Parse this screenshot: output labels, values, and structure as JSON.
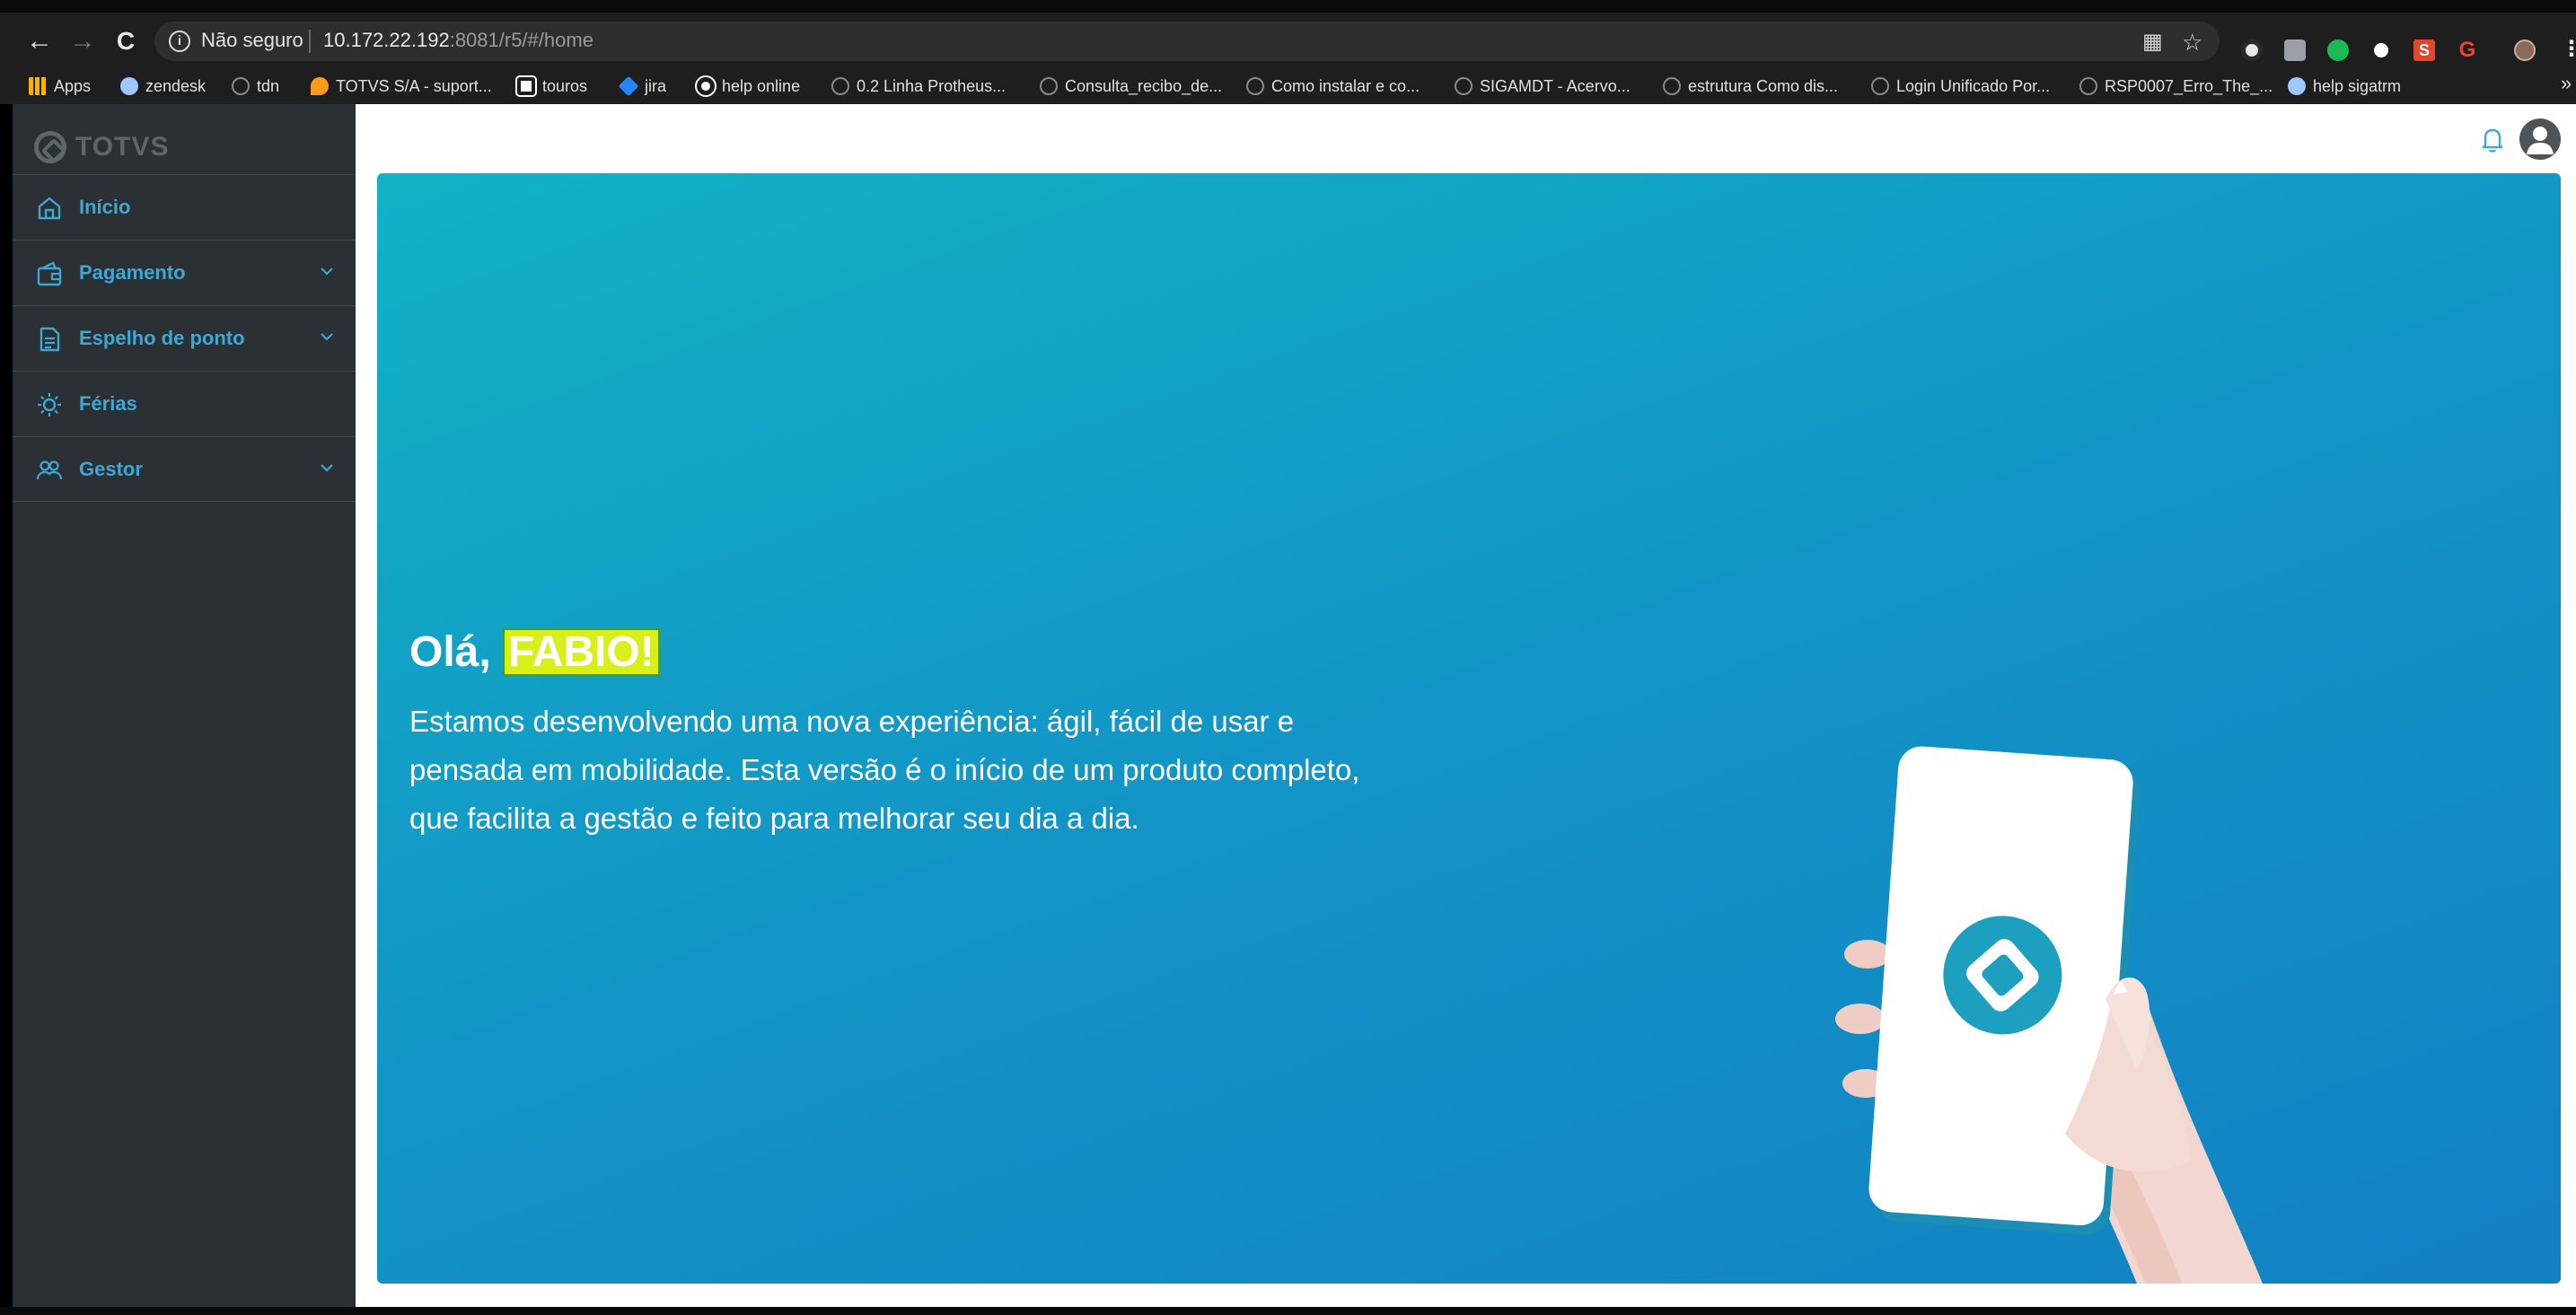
{
  "browser": {
    "security_label": "Não seguro",
    "url_host": "10.172.22.192",
    "url_rest": ":8081/r5/#/home"
  },
  "bookmarks": [
    {
      "label": "Apps",
      "icon": "apps-grid-icon",
      "color": "#f4b400"
    },
    {
      "label": "zendesk",
      "icon": "zendesk-icon",
      "color": "#9ec8ff"
    },
    {
      "label": "tdn",
      "icon": "totvs-icon",
      "color": "#8a8a8a"
    },
    {
      "label": "TOTVS S/A - suport...",
      "icon": "flame-icon",
      "color": "#ff9a1a"
    },
    {
      "label": "touros",
      "icon": "touros-icon",
      "color": "#ffffff"
    },
    {
      "label": "jira",
      "icon": "jira-icon",
      "color": "#2684ff"
    },
    {
      "label": "help online",
      "icon": "globe-icon",
      "color": "#ffffff"
    },
    {
      "label": "0.2 Linha Protheus...",
      "icon": "totvs-icon",
      "color": "#8a8a8a"
    },
    {
      "label": "Consulta_recibo_de...",
      "icon": "totvs-icon",
      "color": "#8a8a8a"
    },
    {
      "label": "Como instalar e co...",
      "icon": "totvs-icon",
      "color": "#8a8a8a"
    },
    {
      "label": "SIGAMDT - Acervo...",
      "icon": "totvs-icon",
      "color": "#8a8a8a"
    },
    {
      "label": "estrutura Como dis...",
      "icon": "totvs-icon",
      "color": "#8a8a8a"
    },
    {
      "label": "Login Unificado Por...",
      "icon": "totvs-icon",
      "color": "#8a8a8a"
    },
    {
      "label": "RSP0007_Erro_The_...",
      "icon": "totvs-icon",
      "color": "#8a8a8a"
    },
    {
      "label": "help sigatrm",
      "icon": "help-icon",
      "color": "#9ec8ff"
    }
  ],
  "app": {
    "logo_text": "TOTVS",
    "accent_color": "#3fa7d3",
    "sidebar_color": "#2a3033"
  },
  "menu": [
    {
      "label": "Início",
      "icon": "home-icon",
      "has_submenu": false
    },
    {
      "label": "Pagamento",
      "icon": "wallet-icon",
      "has_submenu": true
    },
    {
      "label": "Espelho de ponto",
      "icon": "document-icon",
      "has_submenu": true
    },
    {
      "label": "Férias",
      "icon": "sun-icon",
      "has_submenu": false
    },
    {
      "label": "Gestor",
      "icon": "team-icon",
      "has_submenu": true
    }
  ],
  "banner": {
    "greeting_prefix": "Olá,",
    "user_name": "FABIO!",
    "welcome_text": "Estamos desenvolvendo uma nova experiência: ágil, fácil de usar e pensada em mobilidade. Esta versão é o início de um produto completo, que facilita a gestão e feito para melhorar seu dia a dia."
  }
}
